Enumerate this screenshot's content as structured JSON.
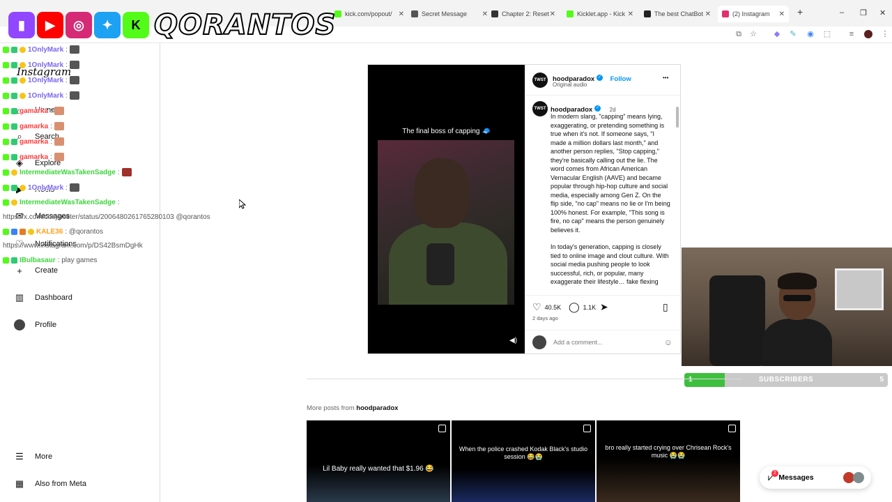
{
  "browser": {
    "tabs": [
      {
        "label": "kick.com/popout/",
        "color": "#53fc18"
      },
      {
        "label": "Secret Message",
        "color": "#555555"
      },
      {
        "label": "Chapter 2: Reset",
        "color": "#333333"
      },
      {
        "label": "Kicklet.app - Kick",
        "color": "#53fc18"
      },
      {
        "label": "The best ChatBot",
        "color": "#222222"
      },
      {
        "label": "(2) Instagram",
        "color": "#e1306c",
        "active": true
      }
    ],
    "new_tab": "+",
    "window_controls": [
      "–",
      "❐",
      "✕"
    ]
  },
  "overlay": {
    "channel_name": "QORANTOS",
    "platforms": [
      {
        "name": "twitch-icon",
        "glyph": "▮",
        "color": "#9146ff"
      },
      {
        "name": "youtube-icon",
        "glyph": "▶",
        "color": "#ff0000"
      },
      {
        "name": "instagram-icon",
        "glyph": "◎",
        "color": "#d62976"
      },
      {
        "name": "twitter-icon",
        "glyph": "✦",
        "color": "#1da1f2"
      },
      {
        "name": "kick-icon",
        "glyph": "K",
        "color": "#53fc18"
      }
    ]
  },
  "chat": [
    {
      "user": "1OnlyMark",
      "color": "#7b68ee",
      "msg": ":"
    },
    {
      "user": "1OnlyMark",
      "color": "#7b68ee",
      "msg": ":"
    },
    {
      "user": "1OnlyMark",
      "color": "#7b68ee",
      "msg": ":"
    },
    {
      "user": "1OnlyMark",
      "color": "#7b68ee",
      "msg": ":"
    },
    {
      "user": "gamarka",
      "color": "#ff3c3c",
      "msg": ":"
    },
    {
      "user": "gamarka",
      "color": "#ff3c3c",
      "msg": ":"
    },
    {
      "user": "gamarka",
      "color": "#ff3c3c",
      "msg": ":"
    },
    {
      "user": "gamarka",
      "color": "#ff3c3c",
      "msg": ":"
    },
    {
      "user": "IntermediateWasTakenSadge",
      "color": "#3bd63b",
      "msg": ":"
    },
    {
      "user": "1OnlyMark",
      "color": "#7b68ee",
      "msg": ":"
    },
    {
      "user": "IntermediateWasTakenSadge",
      "color": "#3bd63b",
      "msg": ":"
    },
    {
      "user": "",
      "color": "#555555",
      "msg": "https://x.com/cosyposter/status/2006480261765280103 @qorantos"
    },
    {
      "user": "KALE36",
      "color": "#ff9e1b",
      "msg": ": @qorantos"
    },
    {
      "user": "",
      "color": "#555555",
      "msg": "https://www.instagram.com/p/DS42BsmDgHk"
    },
    {
      "user": "IBulbasaur",
      "color": "#3bd63b",
      "msg": ": play games"
    }
  ],
  "instagram": {
    "logo": "Instagram",
    "nav": [
      {
        "label": "Home",
        "icon": "home-icon",
        "glyph": "⌂"
      },
      {
        "label": "Search",
        "icon": "search-icon",
        "glyph": "⌕"
      },
      {
        "label": "Explore",
        "icon": "compass-icon",
        "glyph": "◈"
      },
      {
        "label": "Reels",
        "icon": "reels-icon",
        "glyph": "▶"
      },
      {
        "label": "Messages",
        "icon": "messenger-icon",
        "glyph": "✉"
      },
      {
        "label": "Notifications",
        "icon": "heart-icon",
        "glyph": "♡"
      },
      {
        "label": "Create",
        "icon": "plus-icon",
        "glyph": "+"
      },
      {
        "label": "Dashboard",
        "icon": "dashboard-icon",
        "glyph": "▥"
      },
      {
        "label": "Profile",
        "icon": "profile-icon",
        "glyph": ""
      },
      {
        "label": "More",
        "icon": "menu-icon",
        "glyph": "☰"
      },
      {
        "label": "Also from Meta",
        "icon": "meta-icon",
        "glyph": "▦"
      }
    ],
    "post": {
      "video_caption": "The final boss of capping 🧢",
      "username": "hoodparadox",
      "follow": "Follow",
      "audio": "Original audio",
      "more": "•••",
      "time_ago": "2d",
      "caption_p1": "In modern slang, \"capping\" means lying, exaggerating, or pretending something is true when it's not. If someone says, \"I made a million dollars last month,\" and another person replies, \"Stop capping,\" they're basically calling out the lie. The word comes from African American Vernacular English (AAVE) and became popular through hip-hop culture and social media, especially among Gen Z. On the flip side, \"no cap\" means no lie or I'm being 100% honest. For example, \"This song is fire, no cap\" means the person genuinely believes it.",
      "caption_p2": "In today's generation, capping is closely tied to online image and clout culture. With social media pushing people to look successful, rich, or popular, many exaggerate their lifestyle… fake flexing",
      "likes": "40.5K",
      "comments": "1.1K",
      "posted": "2 days ago",
      "comment_placeholder": "Add a comment...",
      "avatar_text": "TWST"
    },
    "more_posts_prefix": "More posts from",
    "more_posts_user": "hoodparadox",
    "thumbs": [
      {
        "caption": "Lil Baby really wanted that $1.96 😂"
      },
      {
        "caption": "When the police crashed Kodak Black's studio session 😂😭"
      },
      {
        "caption": "bro really started crying over Chrisean Rock's music 😭😭"
      }
    ],
    "messages_label": "Messages",
    "messages_badge": "2"
  },
  "subscribers": {
    "label": "SUBSCRIBERS",
    "current": "1",
    "goal": "5",
    "progress": 0.2
  }
}
